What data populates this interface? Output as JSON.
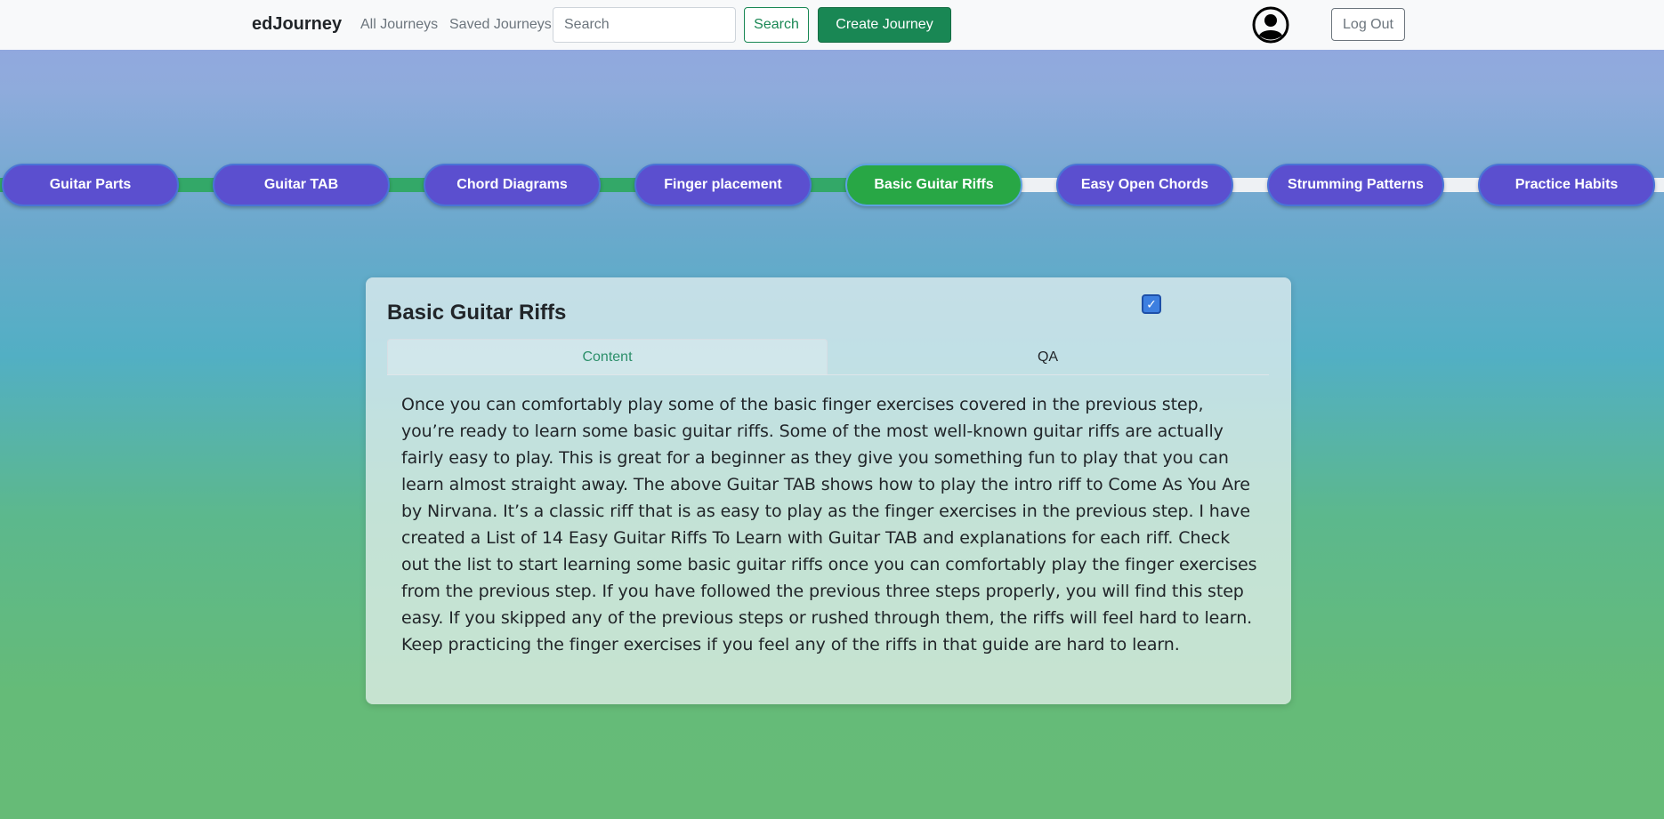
{
  "navbar": {
    "brand": "edJourney",
    "links": [
      "All Journeys",
      "Saved Journeys"
    ],
    "search_placeholder": "Search",
    "search_button": "Search",
    "create_button": "Create Journey",
    "logout_button": "Log Out"
  },
  "steps": [
    {
      "label": "Guitar Parts",
      "status": "done"
    },
    {
      "label": "Guitar TAB",
      "status": "done"
    },
    {
      "label": "Chord Diagrams",
      "status": "done"
    },
    {
      "label": "Finger placement",
      "status": "done"
    },
    {
      "label": "Basic Guitar Riffs",
      "status": "active"
    },
    {
      "label": "Easy Open Chords",
      "status": "todo"
    },
    {
      "label": "Strumming Patterns",
      "status": "todo"
    },
    {
      "label": "Practice Habits",
      "status": "todo"
    }
  ],
  "card": {
    "title": "Basic Guitar Riffs",
    "completed": true,
    "checkmark": "✓",
    "tabs": [
      "Content",
      "QA"
    ],
    "active_tab": "Content",
    "body": "Once you can comfortably play some of the basic finger exercises covered in the previous step, you’re ready to learn some basic guitar riffs. Some of the most well-known guitar riffs are actually fairly easy to play. This is great for a beginner as they give you something fun to play that you can learn almost straight away. The above Guitar TAB shows how to play the intro riff to Come As You Are by Nirvana. It’s a classic riff that is as easy to play as the finger exercises in the previous step. I have created a List of 14 Easy Guitar Riffs To Learn with Guitar TAB and explanations for each riff. Check out the list to start learning some basic guitar riffs once you can comfortably play the finger exercises from the previous step. If you have followed the previous three steps properly, you will find this step easy. If you skipped any of the previous steps or rushed through them, the riffs will feel hard to learn. Keep practicing the finger exercises if you feel any of the riffs in that guide are hard to learn."
  },
  "colors": {
    "step_default": "#5b4fcf",
    "step_active": "#28a745",
    "track_done": "#33a868",
    "track_todo": "#eef1f4",
    "accent_green": "#198754"
  }
}
